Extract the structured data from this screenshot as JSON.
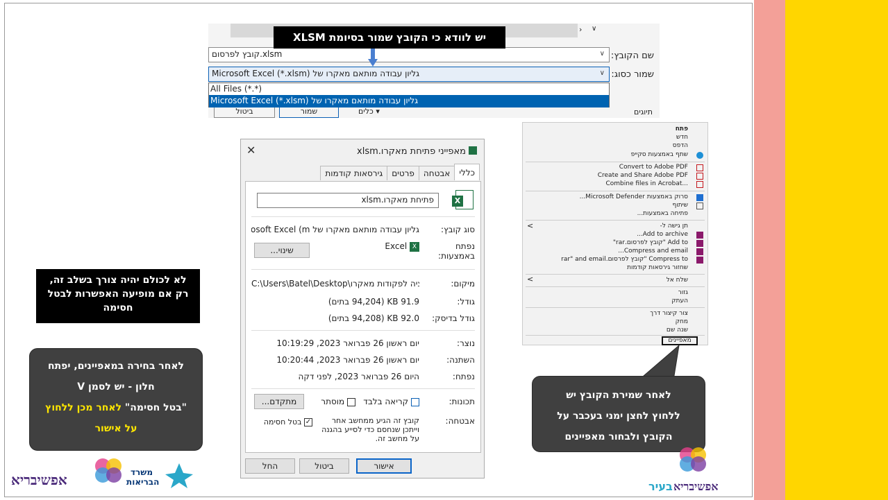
{
  "colors": {
    "pink_strip": "#f3a098",
    "yellow_strip": "#ffd600",
    "selection_blue": "#0063b1",
    "callout_dark": "#404040",
    "highlight_yellow": "#ffe600"
  },
  "save_dialog": {
    "callout": "יש לוודא כי הקובץ שמור בסיומת XLSM",
    "filename_label": "שם הקובץ:",
    "filename_value": "קובץ לפרסום.xlsm",
    "type_label": "שמור כסוג:",
    "type_value": "Microsoft Excel (*.xlsm) גליון עבודה מותאם מאקרו של",
    "options": [
      "All Files (*.*)",
      "Microsoft Excel (*.xlsm) גליון עבודה מותאם מאקרו של"
    ],
    "tools_label": "כלים",
    "save_label": "שמור",
    "cancel_label": "ביטול",
    "tags_label": "תיוגים"
  },
  "properties": {
    "title": "מאפייני פתיחת מאקרו.xlsm",
    "tabs": [
      "כללי",
      "אבטחה",
      "פרטים",
      "גירסאות קודמות"
    ],
    "filename": "פתיחת מאקרו.xlsm",
    "type_label": "סוג קובץ:",
    "type_value": "גליון עבודה מותאם מאקרו של Microsoft Excel (m",
    "opens_label": "נפתח באמצעות:",
    "opens_value": "Excel",
    "change_button": "שינוי...",
    "location_label": "מיקום:",
    "location_value": "C:\\Users\\Batel\\Desktop\\מולציה לפקודות מאקרו",
    "size_label": "גודל:",
    "size_value": "91.9 KB (94,204 בתים)",
    "disk_label": "גודל בדיסק:",
    "disk_value": "92.0 KB (94,208 בתים)",
    "created_label": "נוצר:",
    "created_value": "יום ראשון 26 פברואר 2023, 10:19:29",
    "modified_label": "השתנה:",
    "modified_value": "יום ראשון 26 פברואר 2023, 10:20:44",
    "accessed_label": "נפתח:",
    "accessed_value": "היום 26 פברואר 2023, לפני דקה",
    "attributes_label": "תכונות:",
    "readonly_label": "קריאה בלבד",
    "hidden_label": "מוסתר",
    "advanced_button": "מתקדם...",
    "security_label": "אבטחה:",
    "security_text": "קובץ זה הגיע ממחשב אחר וייתכן שנחסם כדי לסייע בהגנה על מחשב זה.",
    "unblock_label": "בטל חסימה",
    "ok_button": "אישור",
    "cancel_button": "ביטול",
    "apply_button": "החל"
  },
  "context_menu": {
    "items": [
      "פתח",
      "חדש",
      "הדפס",
      "שתף באמצעות סקייפ",
      "Convert to Adobe PDF",
      "Create and Share Adobe PDF",
      "Combine files in Acrobat...",
      "סרוק באמצעות Microsoft Defender...",
      "שיתוף",
      "פתיחה באמצעות...",
      "תן גישה ל-",
      "Add to archive...",
      "Add to \"קובץ לפרסום.rar\"",
      "Compress and email...",
      "Compress to \"קובץ לפרסום.rar\" and email",
      "שחזור גירסאות קודמות",
      "שלח אל",
      "גזור",
      "העתק",
      "צור קיצור דרך",
      "מחק",
      "שנה שם",
      "מאפיינים"
    ]
  },
  "callouts": {
    "left": "לא לכולם יהיה צורך בשלב זה, רק אם מופיעה האפשרות לבטל חסימה",
    "bottom_left_1": "לאחר בחירה במאפיינים, יפתח",
    "bottom_left_2": "חלון - יש לסמן V",
    "bottom_left_3a": "\"בטל חסימה\"",
    "bottom_left_3b": "לאחר מכן ללחוץ",
    "bottom_left_4": "על אישור",
    "bottom_right_1": "לאחר שמירת הקובץ יש",
    "bottom_right_2": "ללחוץ לחצן ימני בעכבר על",
    "bottom_right_3": "הקובץ ולבחור מאפיינים"
  },
  "logos": {
    "left_brand": "אפשיבריא",
    "left_ministry_1": "משרד",
    "left_ministry_2": "הבריאות",
    "right_brand_1": "אפשיבריא",
    "right_brand_2": "בעיר"
  }
}
